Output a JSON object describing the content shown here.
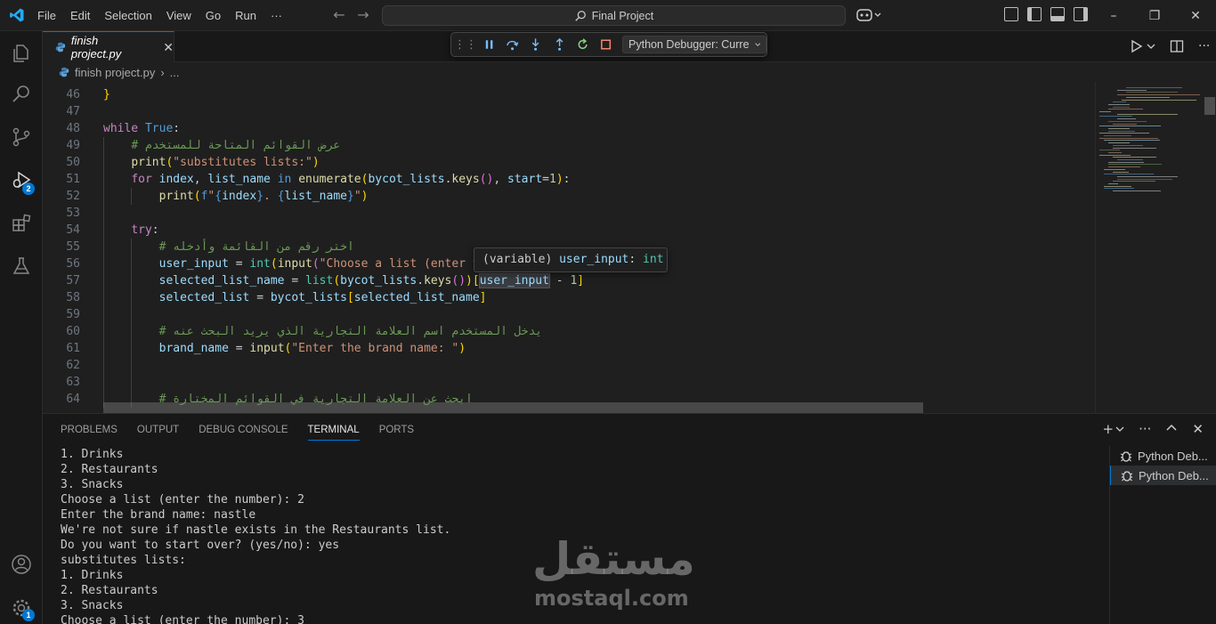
{
  "titlebar": {
    "menu": [
      "File",
      "Edit",
      "Selection",
      "View",
      "Go",
      "Run",
      "···"
    ],
    "command_center": "Final Project"
  },
  "activity": {
    "debug_badge": "2",
    "settings_badge": "1"
  },
  "tab": {
    "label": "finish project.py",
    "close": "✕"
  },
  "debug_toolbar": {
    "config_label": "Python Debugger: Curre"
  },
  "breadcrumb": {
    "file": "finish project.py",
    "more": "..."
  },
  "editor": {
    "lines": [
      {
        "n": "46",
        "html": "<span class='brk1'>}</span>",
        "indent": 0
      },
      {
        "n": "47",
        "html": "",
        "indent": 0
      },
      {
        "n": "48",
        "html": "<span class='kw2'>while</span> <span class='kw'>True</span>:",
        "indent": 0
      },
      {
        "n": "49",
        "html": "    <span class='cmt'># عرض القوائم المتاحة للمستخدم</span>",
        "indent": 1
      },
      {
        "n": "50",
        "html": "    <span class='fn'>print</span><span class='brk1'>(</span><span class='str'>\"substitutes lists:\"</span><span class='brk1'>)</span>",
        "indent": 1
      },
      {
        "n": "51",
        "html": "    <span class='kw2'>for</span> <span class='var'>index</span>, <span class='var'>list_name</span> <span class='kw'>in</span> <span class='fn'>enumerate</span><span class='brk1'>(</span><span class='var'>bycot_lists</span>.<span class='fn'>keys</span><span class='brk2'>()</span>, <span class='var'>start</span>=<span class='num'>1</span><span class='brk1'>)</span>:",
        "indent": 1
      },
      {
        "n": "52",
        "html": "        <span class='fn'>print</span><span class='brk1'>(</span><span class='kw'>f</span><span class='str'>\"</span><span class='kw'>{</span><span class='var'>index</span><span class='kw'>}</span><span class='str'>. </span><span class='kw'>{</span><span class='var'>list_name</span><span class='kw'>}</span><span class='str'>\"</span><span class='brk1'>)</span>",
        "indent": 2
      },
      {
        "n": "53",
        "html": "",
        "indent": 1
      },
      {
        "n": "54",
        "html": "    <span class='kw2'>try</span>:",
        "indent": 1
      },
      {
        "n": "55",
        "html": "        <span class='cmt'># اختر رقم من القائمة وأدخله</span>",
        "indent": 2
      },
      {
        "n": "56",
        "html": "        <span class='var'>user_input</span> = <span class='cls'>int</span><span class='brk1'>(</span><span class='fn'>input</span><span class='brk2'>(</span><span class='str'>\"Choose a list (enter t</span>",
        "indent": 2
      },
      {
        "n": "57",
        "html": "        <span class='var'>selected_list_name</span> = <span class='cls'>list</span><span class='brk1'>(</span><span class='var'>bycot_lists</span>.<span class='fn'>keys</span><span class='brk2'>()</span><span class='brk1'>)</span><span class='brk1'>[</span><span class='var hlword'>user_input</span> - <span class='num'>1</span><span class='brk1'>]</span>",
        "indent": 2
      },
      {
        "n": "58",
        "html": "        <span class='var'>selected_list</span> = <span class='var'>bycot_lists</span><span class='brk1'>[</span><span class='var'>selected_list_name</span><span class='brk1'>]</span>",
        "indent": 2
      },
      {
        "n": "59",
        "html": "",
        "indent": 2
      },
      {
        "n": "60",
        "html": "        <span class='cmt'># يدخل المستخدم اسم العلامة التجارية الذي يريد البحث عنه</span>",
        "indent": 2
      },
      {
        "n": "61",
        "html": "        <span class='var'>brand_name</span> = <span class='fn'>input</span><span class='brk1'>(</span><span class='str'>\"Enter the brand name: \"</span><span class='brk1'>)</span>",
        "indent": 2
      },
      {
        "n": "62",
        "html": "",
        "indent": 2
      },
      {
        "n": "63",
        "html": "",
        "indent": 2
      },
      {
        "n": "64",
        "html": "        <span class='cmt'># ابحث عن العلامة التجارية في القوائم المختارة</span>",
        "indent": 2
      }
    ],
    "hover": {
      "kind": "(variable)",
      "name": "user_input",
      "sep": ":",
      "type": "int"
    }
  },
  "panel": {
    "tabs": [
      "PROBLEMS",
      "OUTPUT",
      "DEBUG CONSOLE",
      "TERMINAL",
      "PORTS"
    ],
    "active_tab": "TERMINAL",
    "terminal_lines": [
      "1. Drinks",
      "2. Restaurants",
      "3. Snacks",
      "Choose a list (enter the number): 2",
      "Enter the brand name: nastle",
      "We're not sure if nastle exists in the Restaurants list.",
      "Do you want to start over? (yes/no): yes",
      "substitutes lists:",
      "1. Drinks",
      "2. Restaurants",
      "3. Snacks",
      "Choose a list (enter the number): 3"
    ],
    "terminals": [
      {
        "label": "Python Deb...",
        "selected": false
      },
      {
        "label": "Python Deb...",
        "selected": true
      }
    ]
  },
  "watermark": {
    "arabic": "مستقل",
    "latin": "mostaql.com"
  },
  "colors": {
    "accent": "#0078d4",
    "background": "#1f1f1f",
    "sidebar": "#181818"
  }
}
